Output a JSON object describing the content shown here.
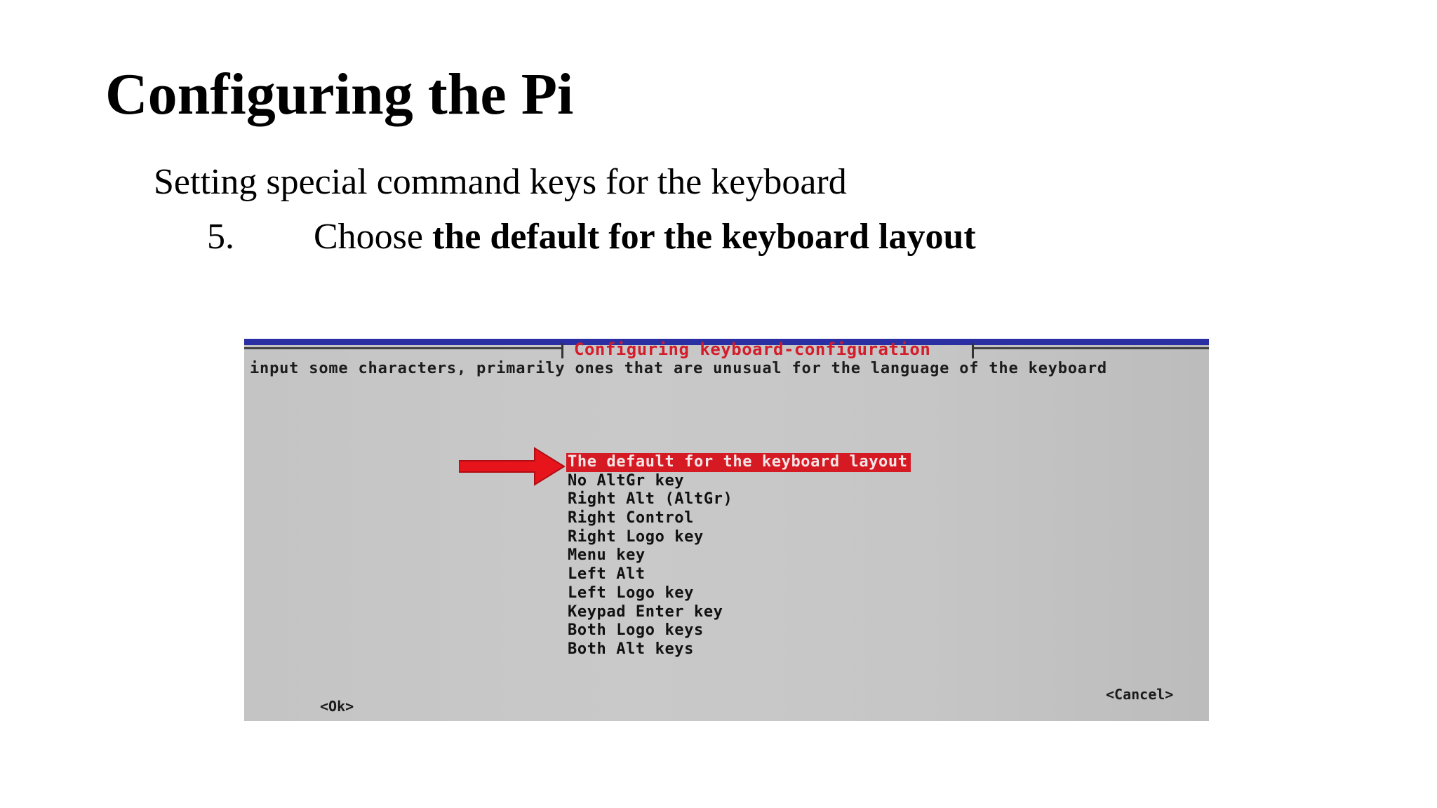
{
  "slide": {
    "title": "Configuring the Pi",
    "subtitle": "Setting special command keys for the keyboard",
    "step": {
      "number": "5.",
      "prefix": "Choose ",
      "emphasis": "the default for the keyboard layout"
    }
  },
  "terminal": {
    "dialog_title": "Configuring keyboard-configuration",
    "description": "input some characters, primarily ones that are unusual for the language of the keyboard",
    "options": [
      "The default for the keyboard layout",
      "No AltGr key",
      "Right Alt (AltGr)",
      "Right Control",
      "Right Logo key",
      "Menu key",
      "Left Alt",
      "Left Logo key",
      "Keypad Enter key",
      "Both Logo keys",
      "Both Alt keys"
    ],
    "selected_index": 0,
    "ok_label": "<Ok>",
    "cancel_label": "<Cancel>",
    "colors": {
      "highlight": "#d61a24",
      "title_text": "#d41c2a",
      "arrow": "#e8141c",
      "top_strip": "#2b2fa4",
      "background": "#c6c6c6"
    },
    "arrow_icon": "right-arrow-icon"
  }
}
